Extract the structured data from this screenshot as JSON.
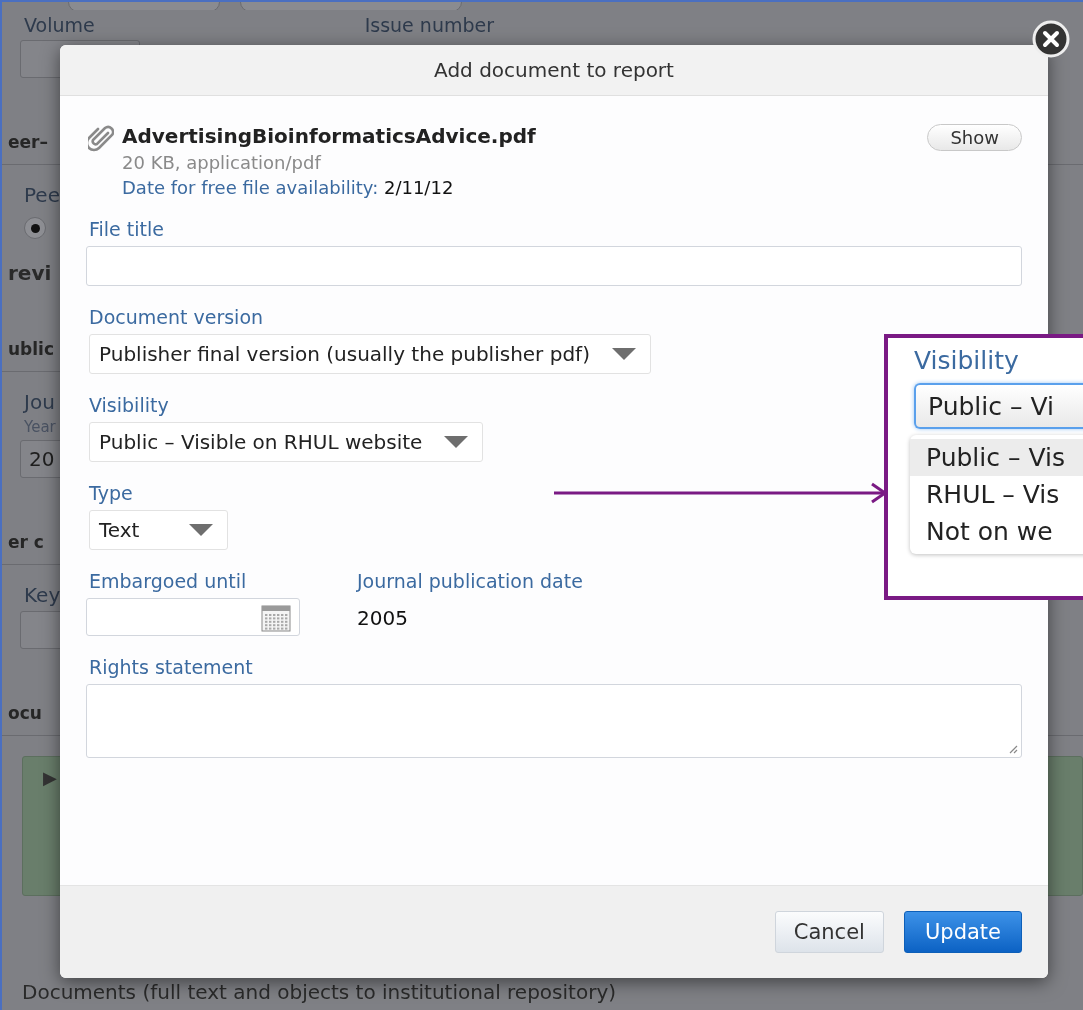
{
  "background": {
    "top_labels": [
      "Volume",
      "Issue number"
    ],
    "left_items": [
      {
        "kind": "input"
      },
      {
        "kind": "heading",
        "text": "eer–"
      },
      {
        "kind": "label",
        "text": "Pee"
      },
      {
        "kind": "radio",
        "checked": true
      },
      {
        "kind": "text",
        "text": "revi"
      },
      {
        "kind": "heading",
        "text": "ublic"
      },
      {
        "kind": "label",
        "text": "Jou"
      },
      {
        "kind": "small",
        "text": "Year"
      },
      {
        "kind": "input",
        "text": "20"
      },
      {
        "kind": "heading",
        "text": "er c"
      },
      {
        "kind": "label",
        "text": "Key"
      },
      {
        "kind": "input"
      },
      {
        "kind": "heading",
        "text": "ocu"
      },
      {
        "kind": "panel",
        "text": "▶"
      }
    ],
    "footer_text": "Documents (full text and objects to institutional repository)"
  },
  "dialog": {
    "title": "Add document to report",
    "attachment": {
      "filename": "AdvertisingBioinformaticsAdvice.pdf",
      "meta": "20 KB, application/pdf",
      "availability_label": "Date for free file availability:",
      "availability_date": "2/11/12"
    },
    "show_button": "Show",
    "fields": [
      {
        "kind": "text",
        "label": "File title"
      },
      {
        "kind": "select",
        "label": "Document version",
        "value": "Publisher final version (usually the publisher pdf)"
      },
      {
        "kind": "select",
        "label": "Visibility",
        "value": "Public – Visible on RHUL website"
      },
      {
        "kind": "select",
        "label": "Type",
        "value": "Text"
      }
    ],
    "embargo": {
      "label": "Embargoed until"
    },
    "publication_date": {
      "label": "Journal publication date",
      "value": "2005"
    },
    "rights": {
      "label": "Rights statement"
    },
    "buttons": [
      {
        "label": "Cancel",
        "kind": "secondary"
      },
      {
        "label": "Update",
        "kind": "primary"
      }
    ]
  },
  "callout": {
    "label": "Visibility",
    "value": "Public – Vi",
    "options": [
      {
        "label": "Public – Vis",
        "selected": true
      },
      {
        "label": "RHUL – Vis",
        "selected": false
      },
      {
        "label": "Not on we",
        "selected": false
      }
    ]
  }
}
